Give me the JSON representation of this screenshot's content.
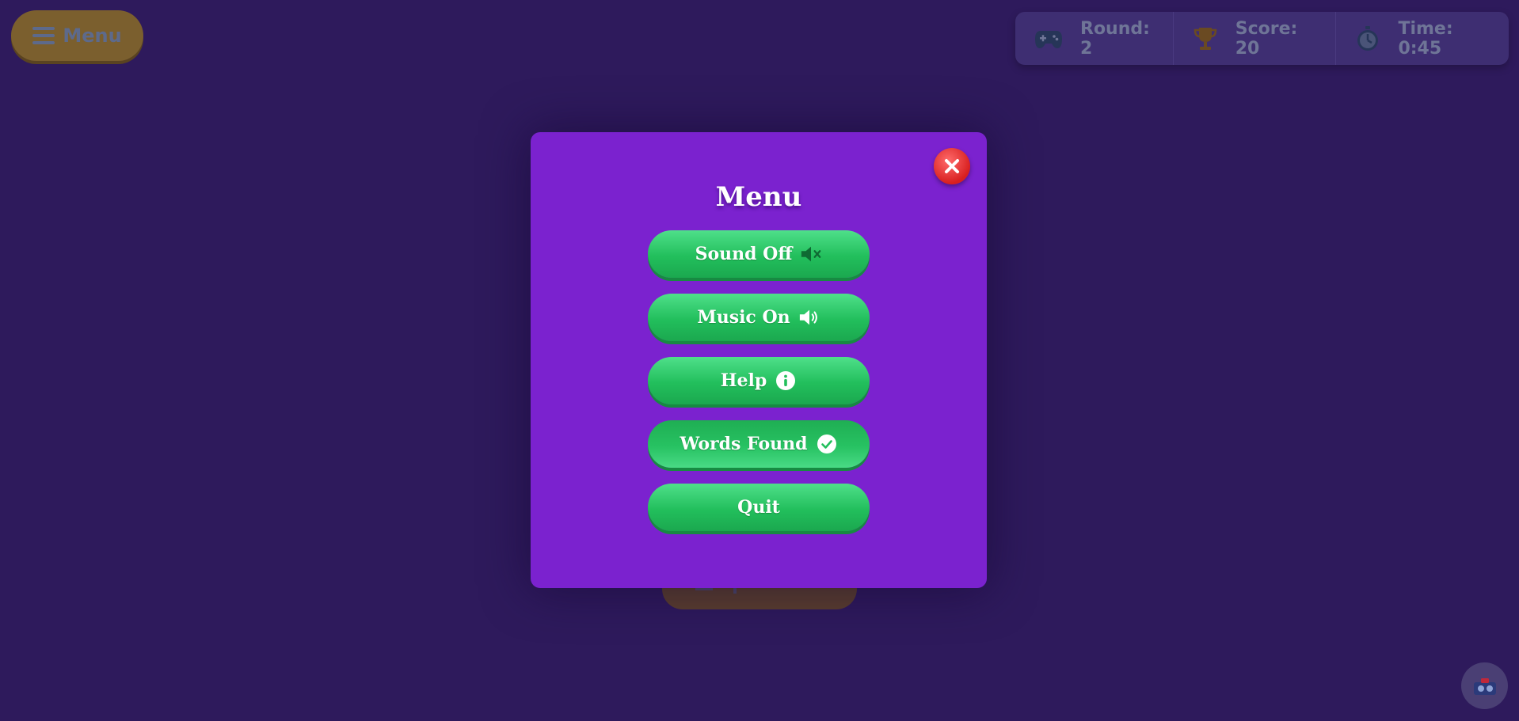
{
  "background": {
    "menu_button": {
      "label": "Menu",
      "icon": "hamburger-icon"
    },
    "status": {
      "round": {
        "label": "Round: 2",
        "icon": "gamepad-icon"
      },
      "score": {
        "label": "Score: 20",
        "icon": "trophy-icon"
      },
      "time": {
        "label": "Time: 0:45",
        "icon": "stopwatch-icon"
      }
    },
    "corner_button": {
      "icon": "camera-icon"
    }
  },
  "modal": {
    "title": "Menu",
    "close_icon": "close-icon",
    "options": [
      {
        "label": "Sound Off",
        "icon": "speaker-muted-icon"
      },
      {
        "label": "Music On",
        "icon": "speaker-on-icon"
      },
      {
        "label": "Help",
        "icon": "info-icon"
      },
      {
        "label": "Words Found",
        "icon": "check-circle-icon",
        "state": "active"
      },
      {
        "label": "Quit",
        "icon": ""
      }
    ]
  },
  "colors": {
    "backdrop": "#2e1a5c",
    "modal_bg": "#7b22cf",
    "button_green": "#22bf5c",
    "close_red": "#d81f1f",
    "menu_button_gold": "#7b5f2e"
  }
}
